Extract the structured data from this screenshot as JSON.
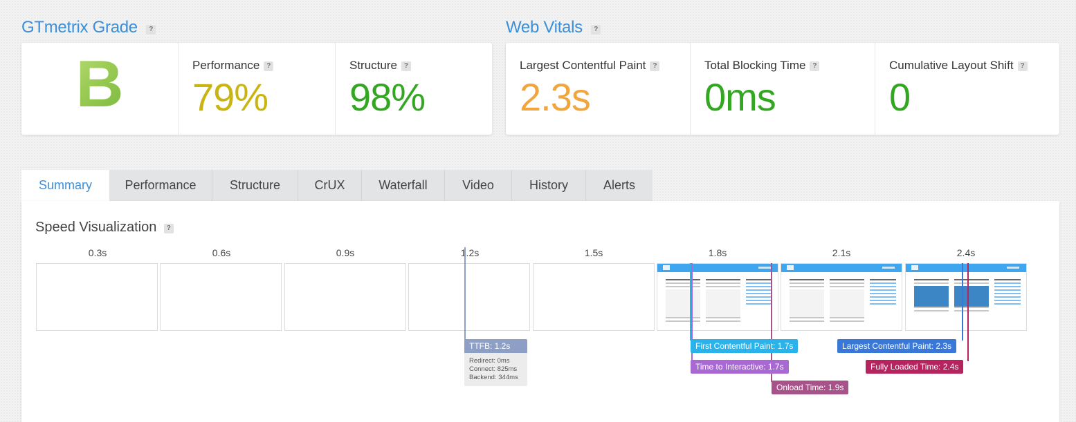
{
  "grade": {
    "title": "GTmetrix Grade",
    "letter": "B",
    "help": "?",
    "metrics": [
      {
        "label": "Performance",
        "value": "79%",
        "color": "#c9b511"
      },
      {
        "label": "Structure",
        "value": "98%",
        "color": "#33a622"
      }
    ]
  },
  "vitals": {
    "title": "Web Vitals",
    "help": "?",
    "metrics": [
      {
        "label": "Largest Contentful Paint",
        "value": "2.3s",
        "color": "#f0a63c"
      },
      {
        "label": "Total Blocking Time",
        "value": "0ms",
        "color": "#33a622"
      },
      {
        "label": "Cumulative Layout Shift",
        "value": "0",
        "color": "#33a622"
      }
    ]
  },
  "tabs": [
    "Summary",
    "Performance",
    "Structure",
    "CrUX",
    "Waterfall",
    "Video",
    "History",
    "Alerts"
  ],
  "active_tab": "Summary",
  "speed": {
    "title": "Speed Visualization",
    "help": "?",
    "ticks": [
      "0.3s",
      "0.6s",
      "0.9s",
      "1.2s",
      "1.5s",
      "1.8s",
      "2.1s",
      "2.4s"
    ],
    "ttfb": {
      "label": "TTFB: 1.2s",
      "color": "#8e9fc6",
      "details": [
        "Redirect: 0ms",
        "Connect: 825ms",
        "Backend: 344ms"
      ]
    },
    "markers": [
      {
        "label": "First Contentful Paint: 1.7s",
        "color": "#29b3ea"
      },
      {
        "label": "Time to Interactive: 1.7s",
        "color": "#a86ad2"
      },
      {
        "label": "Onload Time: 1.9s",
        "color": "#a8528a"
      },
      {
        "label": "Largest Contentful Paint: 2.3s",
        "color": "#3a78d8"
      },
      {
        "label": "Fully Loaded Time: 2.4s",
        "color": "#b5245e"
      }
    ]
  }
}
